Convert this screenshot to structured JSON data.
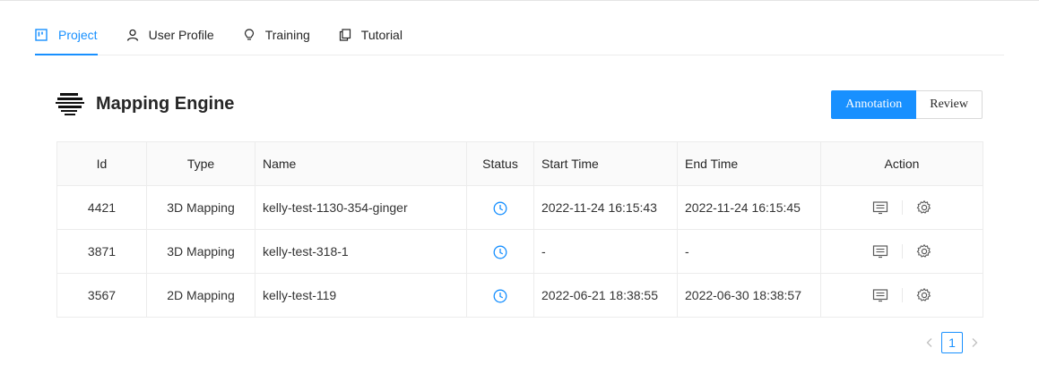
{
  "tabs": [
    {
      "label": "Project",
      "icon": "project-board-icon",
      "active": true
    },
    {
      "label": "User Profile",
      "icon": "user-icon",
      "active": false
    },
    {
      "label": "Training",
      "icon": "bulb-icon",
      "active": false
    },
    {
      "label": "Tutorial",
      "icon": "copy-icon",
      "active": false
    }
  ],
  "header": {
    "title": "Mapping Engine",
    "mode_buttons": [
      "Annotation",
      "Review"
    ],
    "active_mode": "Annotation"
  },
  "table": {
    "columns": [
      "Id",
      "Type",
      "Name",
      "Status",
      "Start Time",
      "End Time",
      "Action"
    ],
    "rows": [
      {
        "id": "4421",
        "type": "3D Mapping",
        "name": "kelly-test-1130-354-ginger",
        "status": "clock-icon",
        "start": "2022-11-24 16:15:43",
        "end": "2022-11-24 16:15:45"
      },
      {
        "id": "3871",
        "type": "3D Mapping",
        "name": "kelly-test-318-1",
        "status": "clock-icon",
        "start": "-",
        "end": "-"
      },
      {
        "id": "3567",
        "type": "2D Mapping",
        "name": "kelly-test-119",
        "status": "clock-icon",
        "start": "2022-06-21 18:38:55",
        "end": "2022-06-30 18:38:57"
      }
    ]
  },
  "pagination": {
    "current_page": "1"
  },
  "colors": {
    "accent": "#1890ff",
    "border": "#ececec",
    "header_bg": "#fafafa"
  }
}
